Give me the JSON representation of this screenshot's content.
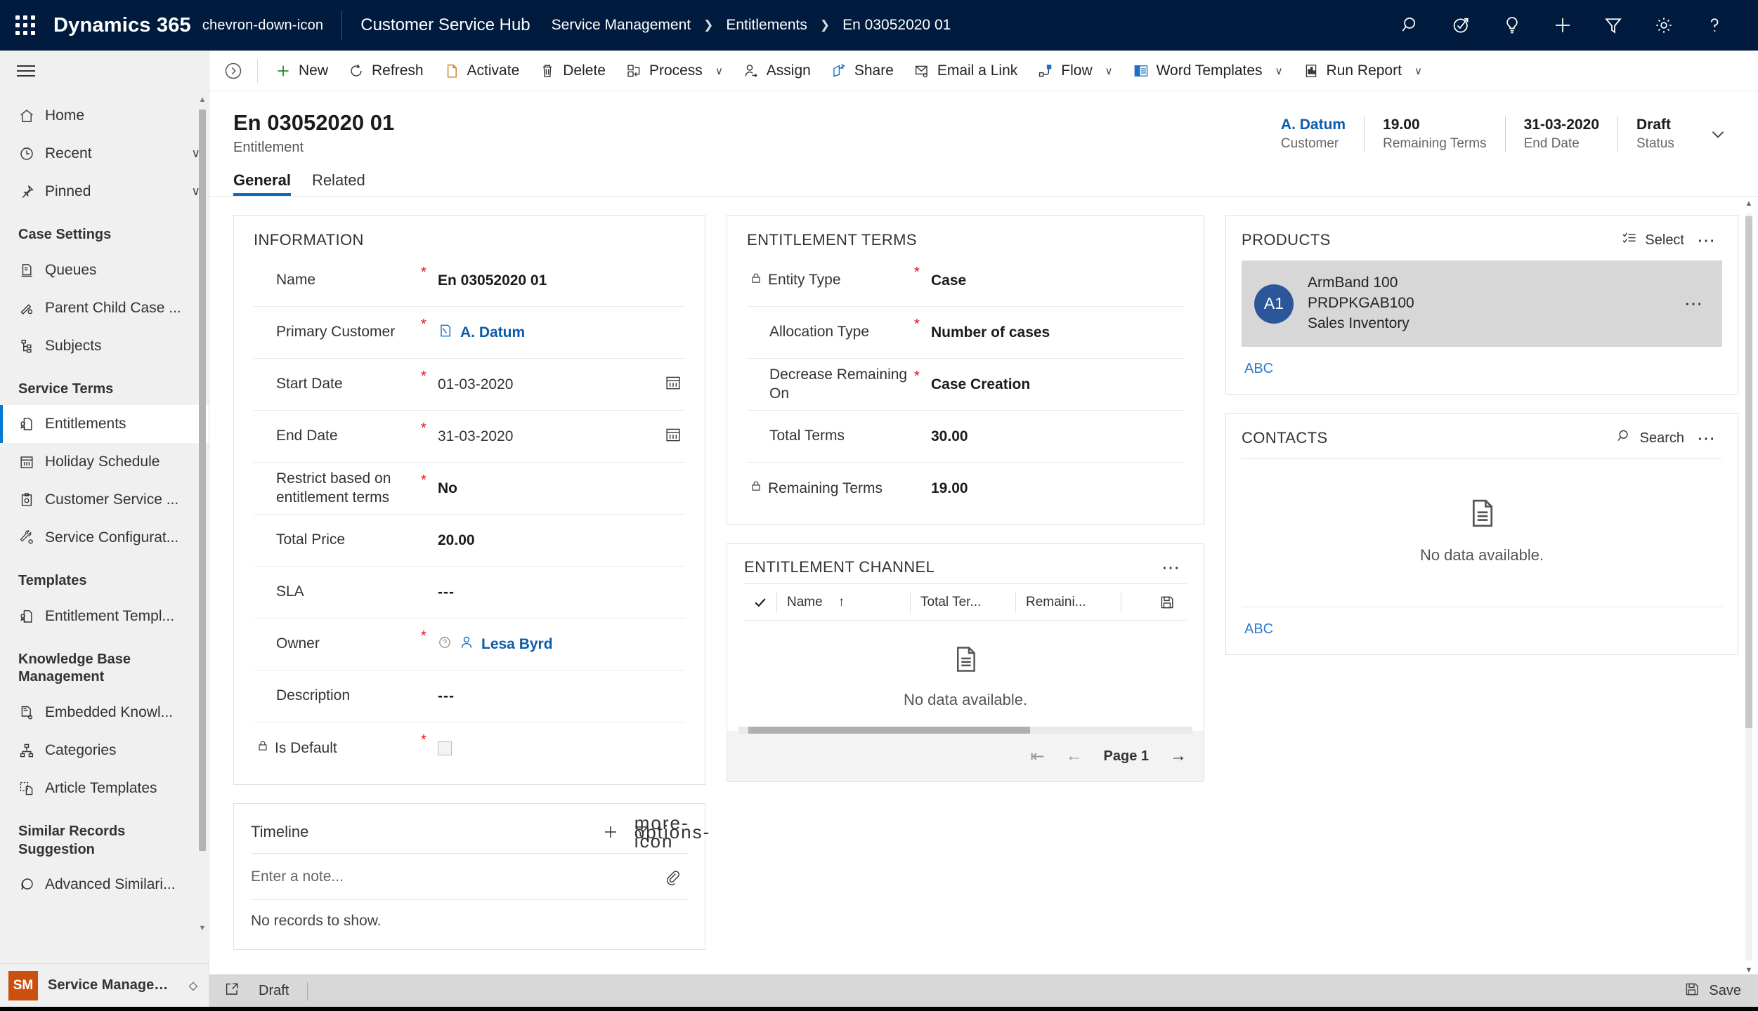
{
  "topnav": {
    "waffle_icon": "app-launcher-icon",
    "brand": "Dynamics 365",
    "brand_chevron": "chevron-down-icon",
    "app_title": "Customer Service Hub",
    "breadcrumb": [
      "Service Management",
      "Entitlements",
      "En 03052020 01"
    ],
    "icons": [
      "search-icon",
      "assistant-icon",
      "insights-lightbulb-icon",
      "quick-create-plus-icon",
      "filter-icon",
      "settings-gear-icon",
      "help-question-icon"
    ]
  },
  "sidebar": {
    "hamburger_icon": "hamburger-menu-icon",
    "items": [
      {
        "label": "Home",
        "icon": "home-icon",
        "caret": ""
      },
      {
        "label": "Recent",
        "icon": "clock-icon",
        "caret": "∨"
      },
      {
        "label": "Pinned",
        "icon": "pin-icon",
        "caret": "∨"
      }
    ],
    "groups": [
      {
        "title": "Case Settings",
        "items": [
          {
            "label": "Queues",
            "icon": "queue-icon"
          },
          {
            "label": "Parent Child Case ...",
            "icon": "parent-child-case-icon"
          },
          {
            "label": "Subjects",
            "icon": "subjects-hierarchy-icon"
          }
        ]
      },
      {
        "title": "Service Terms",
        "items": [
          {
            "label": "Entitlements",
            "icon": "entitlement-icon",
            "selected": true
          },
          {
            "label": "Holiday Schedule",
            "icon": "calendar-icon"
          },
          {
            "label": "Customer Service ...",
            "icon": "customer-service-schedule-icon"
          },
          {
            "label": "Service Configurat...",
            "icon": "service-configuration-icon"
          }
        ]
      },
      {
        "title": "Templates",
        "items": [
          {
            "label": "Entitlement Templ...",
            "icon": "entitlement-template-icon"
          }
        ]
      },
      {
        "title": "Knowledge Base Management",
        "items": [
          {
            "label": "Embedded Knowl...",
            "icon": "embedded-knowledge-icon"
          },
          {
            "label": "Categories",
            "icon": "categories-icon"
          },
          {
            "label": "Article Templates",
            "icon": "article-template-icon"
          }
        ]
      },
      {
        "title": "Similar Records Suggestion",
        "items": [
          {
            "label": "Advanced Similari...",
            "icon": "advanced-similarity-icon"
          }
        ]
      }
    ],
    "footer": {
      "initials": "SM",
      "label": "Service Managem...",
      "switcher_icon": "area-switcher-icon"
    }
  },
  "commandbar": {
    "collapse_icon": "collapse-pane-icon",
    "commands": [
      {
        "label": "New",
        "icon": "plus-icon"
      },
      {
        "label": "Refresh",
        "icon": "refresh-icon"
      },
      {
        "label": "Activate",
        "icon": "activate-document-icon"
      },
      {
        "label": "Delete",
        "icon": "trash-icon"
      },
      {
        "label": "Process",
        "icon": "process-icon",
        "chevron": "∨"
      },
      {
        "label": "Assign",
        "icon": "assign-person-icon"
      },
      {
        "label": "Share",
        "icon": "share-icon"
      },
      {
        "label": "Email a Link",
        "icon": "email-link-icon"
      },
      {
        "label": "Flow",
        "icon": "flow-icon",
        "chevron": "∨"
      },
      {
        "label": "Word Templates",
        "icon": "word-template-icon",
        "chevron": "∨"
      },
      {
        "label": "Run Report",
        "icon": "run-report-icon",
        "chevron": "∨"
      }
    ]
  },
  "record": {
    "title": "En 03052020 01",
    "subtitle": "Entitlement",
    "header_fields": [
      {
        "value": "A. Datum",
        "label": "Customer",
        "is_link": true
      },
      {
        "value": "19.00",
        "label": "Remaining Terms",
        "is_link": false
      },
      {
        "value": "31-03-2020",
        "label": "End Date",
        "is_link": false
      },
      {
        "value": "Draft",
        "label": "Status",
        "is_link": false
      }
    ],
    "expand_icon": "chevron-down-icon",
    "tabs": [
      {
        "label": "General",
        "active": true
      },
      {
        "label": "Related",
        "active": false
      }
    ]
  },
  "information": {
    "title": "INFORMATION",
    "fields": [
      {
        "label": "Name",
        "required": true,
        "value": "En 03052020 01",
        "type": "text"
      },
      {
        "label": "Primary Customer",
        "required": true,
        "value": "A. Datum",
        "type": "lookup-account"
      },
      {
        "label": "Start Date",
        "required": true,
        "value": "01-03-2020",
        "type": "date"
      },
      {
        "label": "End Date",
        "required": true,
        "value": "31-03-2020",
        "type": "date"
      },
      {
        "label": "Restrict based on entitlement terms",
        "required": true,
        "value": "No",
        "type": "text"
      },
      {
        "label": "Total Price",
        "required": false,
        "value": "20.00",
        "type": "text"
      },
      {
        "label": "SLA",
        "required": false,
        "value": "---",
        "type": "text"
      },
      {
        "label": "Owner",
        "required": true,
        "value": "Lesa Byrd",
        "type": "lookup-user"
      },
      {
        "label": "Description",
        "required": false,
        "value": "---",
        "type": "text"
      },
      {
        "label": "Is Default",
        "required": true,
        "value": "",
        "type": "checkbox",
        "locked": true
      }
    ]
  },
  "entitlement_terms": {
    "title": "ENTITLEMENT TERMS",
    "fields": [
      {
        "label": "Entity Type",
        "required": true,
        "value": "Case",
        "locked": true
      },
      {
        "label": "Allocation Type",
        "required": true,
        "value": "Number of cases",
        "locked": false
      },
      {
        "label": "Decrease Remaining On",
        "required": true,
        "value": "Case Creation",
        "locked": false
      },
      {
        "label": "Total Terms",
        "required": false,
        "value": "30.00",
        "locked": false
      },
      {
        "label": "Remaining Terms",
        "required": false,
        "value": "19.00",
        "locked": true
      }
    ]
  },
  "entitlement_channel": {
    "title": "ENTITLEMENT CHANNEL",
    "more_icon": "more-options-icon",
    "columns": [
      {
        "label": "Name",
        "sort": "↑"
      },
      {
        "label": "Total Ter...",
        "sort": ""
      },
      {
        "label": "Remaini...",
        "sort": ""
      }
    ],
    "save_icon": "save-grid-icon",
    "select_all_icon": "check-icon",
    "empty_icon": "empty-document-icon",
    "empty_text": "No data available.",
    "pager": {
      "first_icon": "first-page-icon",
      "prev_icon": "previous-page-icon",
      "page_label": "Page 1",
      "next_icon": "next-page-icon"
    }
  },
  "products": {
    "title": "PRODUCTS",
    "select_label": "Select",
    "select_icon": "multiselect-list-icon",
    "more_icon": "more-options-icon",
    "rows": [
      {
        "initials": "A1",
        "name": "ArmBand 100",
        "code": "PRDPKGAB100",
        "category": "Sales Inventory",
        "row_more_icon": "more-options-icon"
      }
    ],
    "footer_link": "ABC"
  },
  "contacts": {
    "title": "CONTACTS",
    "search_label": "Search",
    "search_icon": "search-icon",
    "more_icon": "more-options-icon",
    "empty_icon": "empty-document-icon",
    "empty_text": "No data available.",
    "footer_link": "ABC"
  },
  "timeline": {
    "title": "Timeline",
    "add_icon": "plus-icon",
    "filter_icon": "filter-icon",
    "more_icon": "more-options-icon",
    "note_placeholder": "Enter a note...",
    "note_value": "",
    "attach_icon": "paperclip-icon",
    "empty_text": "No records to show."
  },
  "statusbar": {
    "popout_icon": "open-in-new-window-icon",
    "status": "Draft",
    "save_label": "Save",
    "save_icon": "save-icon"
  },
  "colors": {
    "nav_bg": "#001B3D",
    "accent": "#0f6cbd",
    "link": "#0B5CAB",
    "required": "#e00b1c",
    "avatar_product": "#2b579a",
    "avatar_user": "#ca5010"
  }
}
